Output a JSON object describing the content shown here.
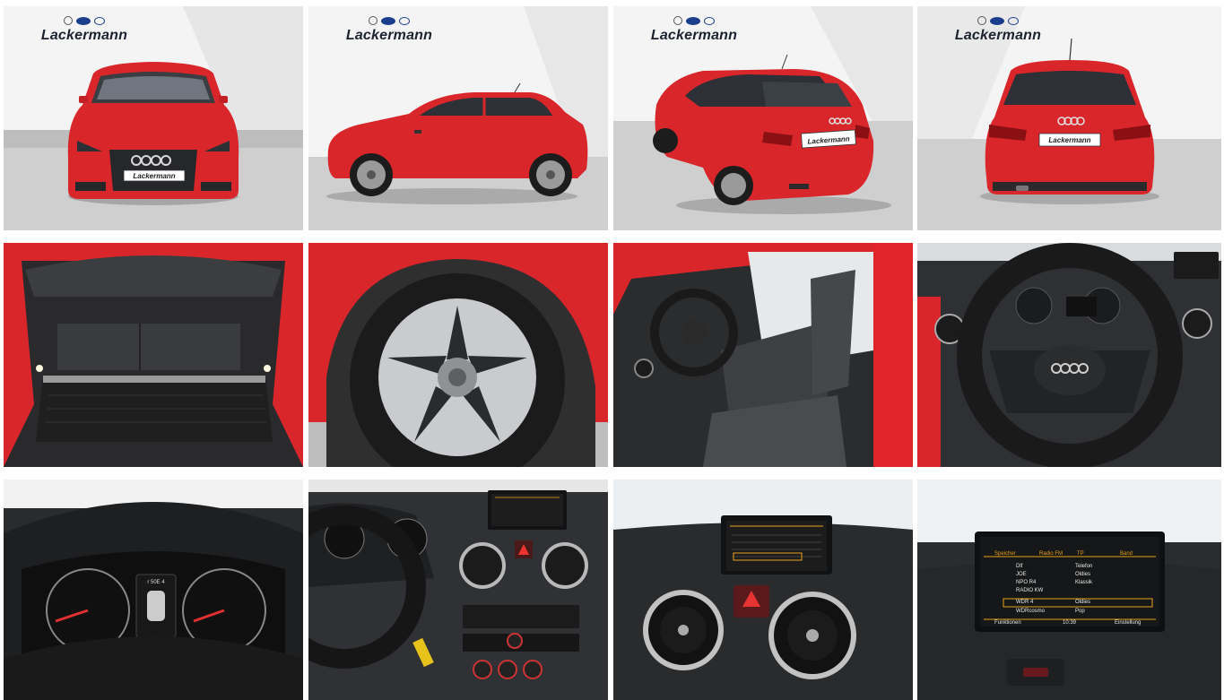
{
  "gallery": {
    "dealer": {
      "name": "Lackermann",
      "logos": [
        "opel-logo",
        "ford-logo",
        "hyundai-logo"
      ]
    },
    "colors": {
      "car_body": "#d9262b",
      "floor": "#cfcfcf",
      "backdrop": "#f2f2f2",
      "interior": "#2b2b2b"
    },
    "photos": [
      {
        "view": "front"
      },
      {
        "view": "side"
      },
      {
        "view": "rear-three-quarter"
      },
      {
        "view": "rear"
      },
      {
        "view": "trunk"
      },
      {
        "view": "wheel"
      },
      {
        "view": "front-seats"
      },
      {
        "view": "steering-wheel"
      },
      {
        "view": "instrument-cluster"
      },
      {
        "view": "dashboard"
      },
      {
        "view": "center-console"
      },
      {
        "view": "infotainment-screen"
      }
    ],
    "cluster_display": {
      "top": "r 50E 4"
    },
    "radio_screen": {
      "header_left": "Speicher",
      "header_center": "Radio FM",
      "header_badge": "TP",
      "header_right": "Band",
      "stations": [
        {
          "name": "Dlf",
          "genre": "Telefon"
        },
        {
          "name": "JOE",
          "genre": "Oldies"
        },
        {
          "name": "NPO R4",
          "genre": "Klassik"
        },
        {
          "name": "RADIO KW",
          "genre": ""
        },
        {
          "name": "WDR 4",
          "genre": "Oldies"
        },
        {
          "name": "WDRcosmo",
          "genre": "Pop"
        }
      ],
      "footer_left": "Funktionen",
      "footer_center": "10:39",
      "footer_right": "Einstellung"
    }
  }
}
